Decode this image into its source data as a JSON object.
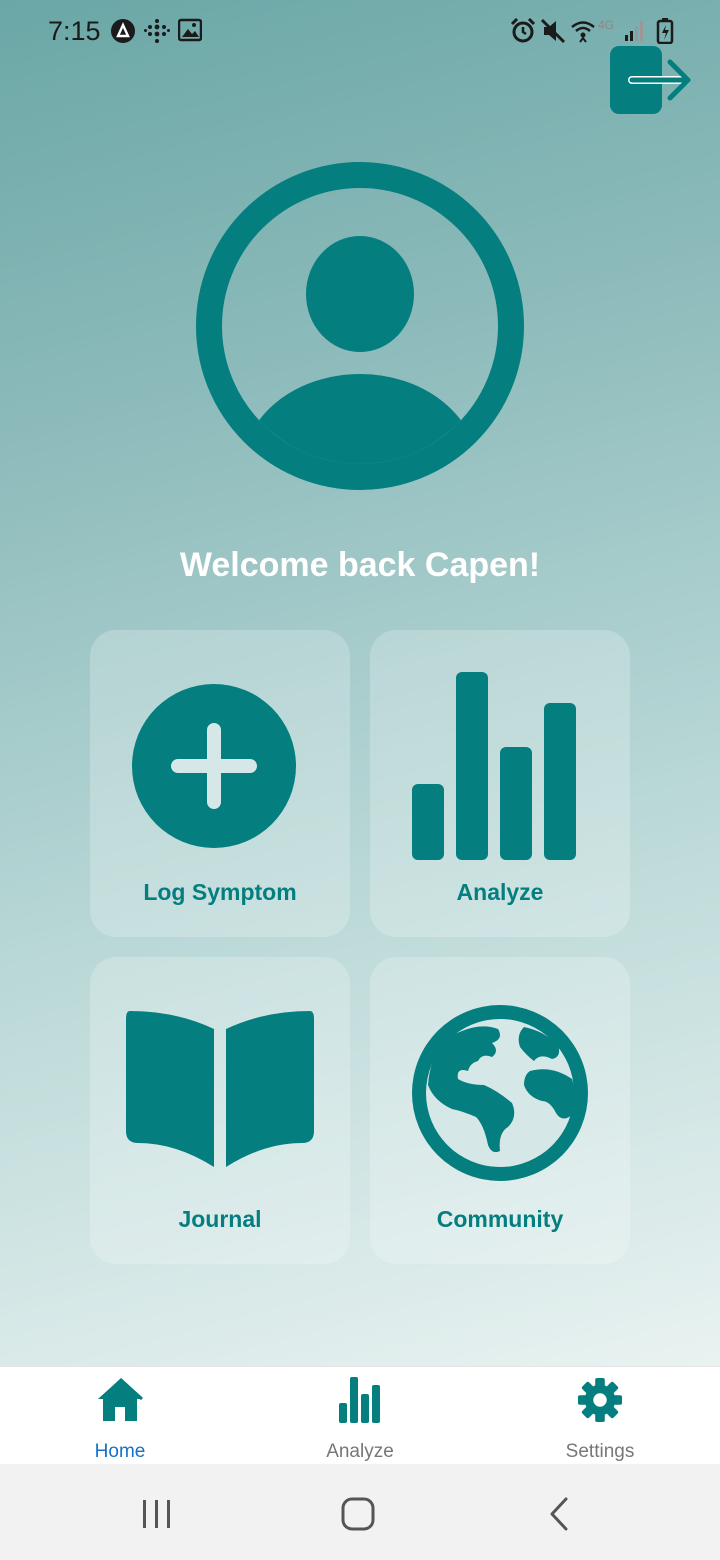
{
  "status_bar": {
    "time": "7:15",
    "network_label": "4G"
  },
  "welcome_text": "Welcome back Capen!",
  "tiles": [
    {
      "label": "Log Symptom",
      "icon": "plus-circle-icon"
    },
    {
      "label": "Analyze",
      "icon": "bar-chart-icon"
    },
    {
      "label": "Journal",
      "icon": "open-book-icon"
    },
    {
      "label": "Community",
      "icon": "globe-icon"
    }
  ],
  "bottom_nav": [
    {
      "label": "Home",
      "icon": "home-icon",
      "active": true
    },
    {
      "label": "Analyze",
      "icon": "bar-chart-icon",
      "active": false
    },
    {
      "label": "Settings",
      "icon": "gear-icon",
      "active": false
    }
  ],
  "colors": {
    "accent": "#047e7e",
    "active_tab": "#1572c6",
    "inactive_tab": "#777777",
    "welcome_text": "#ffffff"
  }
}
